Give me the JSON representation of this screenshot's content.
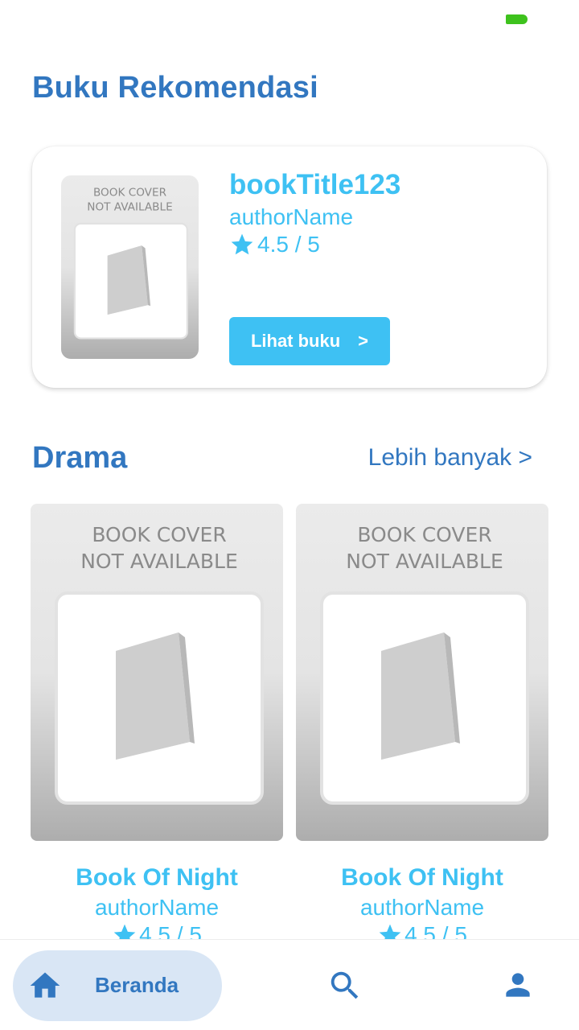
{
  "colors": {
    "primary_blue": "#3277c0",
    "accent_cyan": "#3ec1f3",
    "nav_active_bg": "#d9e6f5",
    "battery_green": "#3ec21d"
  },
  "page": {
    "title": "Buku Rekomendasi"
  },
  "recommendation": {
    "cover_text_line1": "BOOK COVER",
    "cover_text_line2": "NOT AVAILABLE",
    "title": "bookTitle123",
    "author": "authorName",
    "rating": "4.5 / 5",
    "button_label": "Lihat buku",
    "button_arrow": ">"
  },
  "drama": {
    "title": "Drama",
    "more_link": "Lebih banyak >",
    "books": [
      {
        "cover_text_line1": "BOOK COVER",
        "cover_text_line2": "NOT AVAILABLE",
        "title": "Book Of Night",
        "author": "authorName",
        "rating": "4.5 / 5"
      },
      {
        "cover_text_line1": "BOOK COVER",
        "cover_text_line2": "NOT AVAILABLE",
        "title": "Book Of Night",
        "author": "authorName",
        "rating": "4.5 / 5"
      }
    ]
  },
  "bottom_nav": {
    "home_label": "Beranda",
    "icons": [
      "home-icon",
      "search-icon",
      "profile-icon"
    ]
  }
}
